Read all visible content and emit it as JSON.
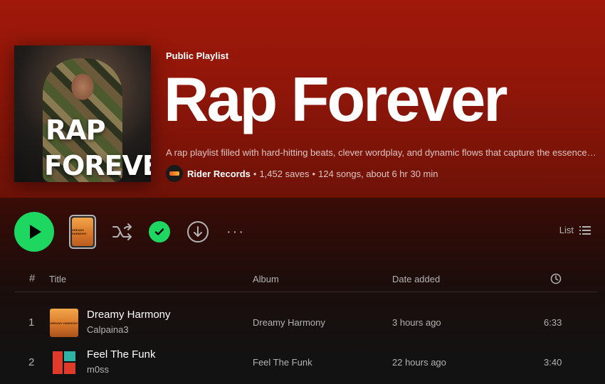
{
  "playlist": {
    "type_label": "Public Playlist",
    "title": "Rap Forever",
    "cover_text_line1": "RAP",
    "cover_text_line2": "FOREVER",
    "description": "A rap playlist filled with hard-hitting beats, clever wordplay, and dynamic flows that capture the essence of hip-hop.",
    "owner": "Rider Records",
    "saves": "1,452 saves",
    "songs_duration": "124 songs, about 6 hr 30 min",
    "separator": "•"
  },
  "actions": {
    "play_icon": "play-icon",
    "shuffle_icon": "shuffle-icon",
    "saved_icon": "check-icon",
    "download_icon": "download-icon",
    "more_label": "···",
    "view_label": "List",
    "mini_cover_text": "DREAMY HARMONY"
  },
  "table": {
    "headers": {
      "num": "#",
      "title": "Title",
      "album": "Album",
      "date": "Date added",
      "duration_icon": "clock-icon"
    },
    "rows": [
      {
        "num": "1",
        "title": "Dreamy Harmony",
        "artist": "Calpaina3",
        "album": "Dreamy Harmony",
        "date": "3 hours ago",
        "duration": "6:33",
        "thumb_text": "DREAMY HARMONY"
      },
      {
        "num": "2",
        "title": "Feel The Funk",
        "artist": "m0ss",
        "album": "Feel The Funk",
        "date": "22 hours ago",
        "duration": "3:40"
      }
    ]
  },
  "colors": {
    "accent": "#1ed760",
    "hero": "#a0190a",
    "background": "#121212"
  }
}
